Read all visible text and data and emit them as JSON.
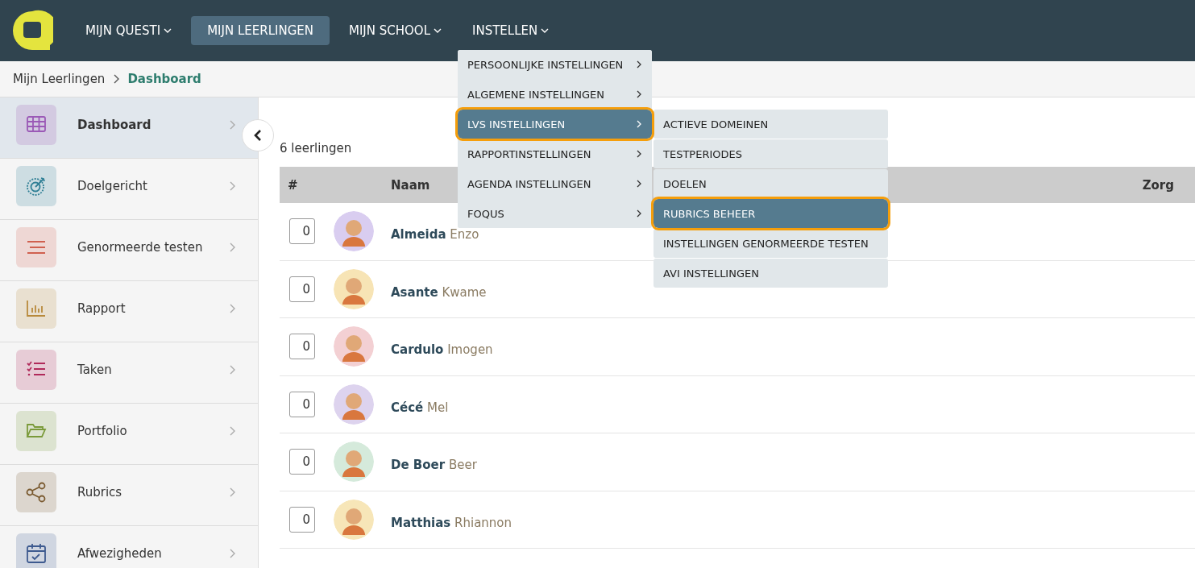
{
  "nav": {
    "items": [
      {
        "label": "MIJN QUESTI",
        "dropdown": true,
        "selected": false
      },
      {
        "label": "MIJN LEERLINGEN",
        "dropdown": false,
        "selected": true
      },
      {
        "label": "MIJN SCHOOL",
        "dropdown": true,
        "selected": false
      },
      {
        "label": "INSTELLEN",
        "dropdown": true,
        "selected": false
      }
    ]
  },
  "breadcrumb": [
    {
      "label": "Mijn Leerlingen",
      "current": false
    },
    {
      "label": "Dashboard",
      "current": true
    }
  ],
  "sidebar": {
    "items": [
      {
        "label": "Dashboard",
        "kind": "grid",
        "color": "#9b59b6",
        "selected": true
      },
      {
        "label": "Doelgericht",
        "kind": "target",
        "color": "#2f7f95",
        "selected": false
      },
      {
        "label": "Genormeerde testen",
        "kind": "lines",
        "color": "#d0604f",
        "selected": false
      },
      {
        "label": "Rapport",
        "kind": "chart",
        "color": "#b88a3c",
        "selected": false
      },
      {
        "label": "Taken",
        "kind": "checklist",
        "color": "#b02a5a",
        "selected": false
      },
      {
        "label": "Portfolio",
        "kind": "folder",
        "color": "#7a9a3a",
        "selected": false
      },
      {
        "label": "Rubrics",
        "kind": "share",
        "color": "#7a5a30",
        "selected": false
      },
      {
        "label": "Afwezigheden",
        "kind": "calendar",
        "color": "#3d5a8f",
        "selected": false
      }
    ]
  },
  "count": "6 leerlingen",
  "table": {
    "columns": [
      "#",
      "Naam",
      "Zorg"
    ],
    "rows": [
      {
        "number": "0",
        "last": "Almeida",
        "first": "Enzo",
        "color": "#d9cdf0"
      },
      {
        "number": "0",
        "last": "Asante",
        "first": "Kwame",
        "color": "#f7e4b5"
      },
      {
        "number": "0",
        "last": "Cardulo",
        "first": "Imogen",
        "color": "#f3d0d3"
      },
      {
        "number": "0",
        "last": "Cécé",
        "first": "Mel",
        "color": "#ddd3ee"
      },
      {
        "number": "0",
        "last": "De Boer",
        "first": "Beer",
        "color": "#d5eadb"
      },
      {
        "number": "0",
        "last": "Matthias",
        "first": "Rhiannon",
        "color": "#f7e6b8"
      }
    ]
  },
  "menu": {
    "items": [
      {
        "label": "PERSOONLIJKE INSTELLINGEN",
        "selected": false
      },
      {
        "label": "ALGEMENE INSTELLINGEN",
        "selected": false
      },
      {
        "label": "LVS INSTELLINGEN",
        "selected": true
      },
      {
        "label": "RAPPORTINSTELLINGEN",
        "selected": false
      },
      {
        "label": "AGENDA INSTELLINGEN",
        "selected": false
      },
      {
        "label": "FOQUS",
        "selected": false
      }
    ],
    "submenu": [
      {
        "label": "ACTIEVE DOMEINEN",
        "selected": false
      },
      {
        "label": "TESTPERIODES",
        "selected": false
      },
      {
        "label": "DOELEN",
        "selected": false
      },
      {
        "label": "RUBRICS BEHEER",
        "selected": true
      },
      {
        "label": "INSTELLINGEN GENORMEERDE TESTEN",
        "selected": false
      },
      {
        "label": "AVI INSTELLINGEN",
        "selected": false
      }
    ]
  }
}
